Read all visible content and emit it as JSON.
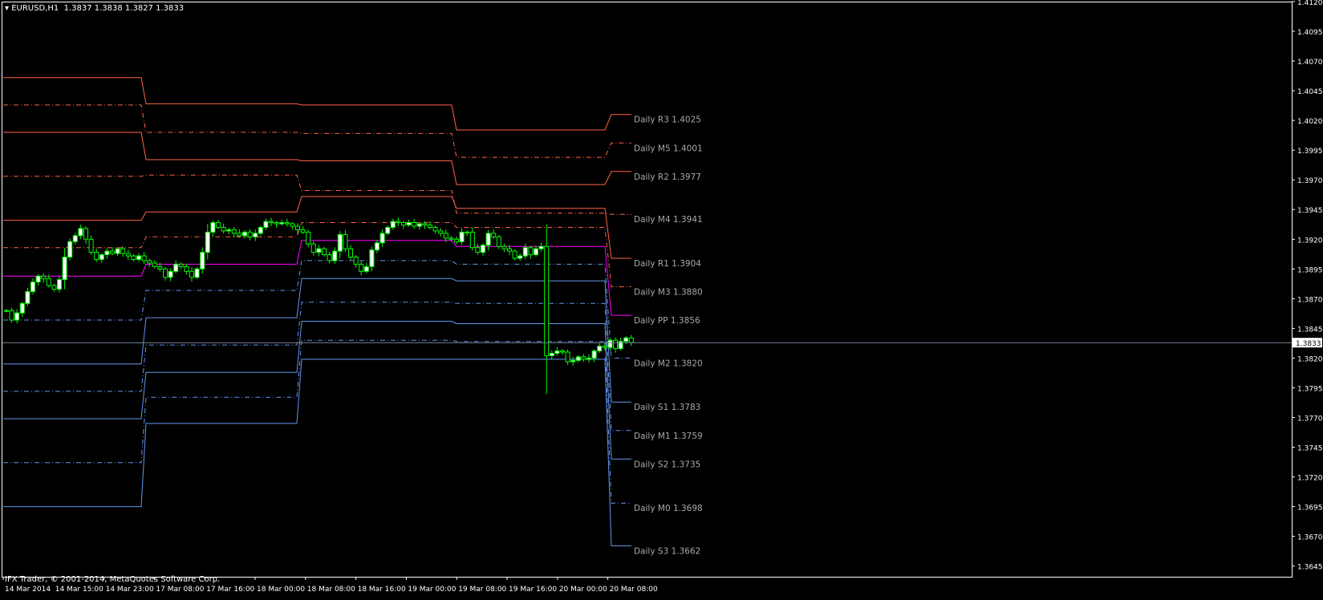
{
  "header": {
    "symbol": "EURUSD,H1",
    "ohlc": "1.3837 1.3838 1.3827 1.3833"
  },
  "footer": {
    "copyright": "IFX Trader, © 2001-2014, MetaQuotes Software Corp."
  },
  "current_price": "1.3833",
  "colors": {
    "background": "#000000",
    "frame": "#ffffff",
    "resistance": "#ff6347",
    "pivot": "#ff00ff",
    "support": "#6495ed",
    "label": "#a9a9a9",
    "bull_candle": "#ffffff",
    "wick": "#00ff00",
    "price_line": "#778899"
  },
  "chart_data": {
    "type": "candlestick",
    "ylim": [
      1.3636,
      1.412
    ],
    "y_ticks": [
      "1.4120",
      "1.4095",
      "1.4070",
      "1.4045",
      "1.4020",
      "1.3995",
      "1.3970",
      "1.3945",
      "1.3920",
      "1.3895",
      "1.3870",
      "1.3845",
      "1.3820",
      "1.3795",
      "1.3770",
      "1.3745",
      "1.3720",
      "1.3695",
      "1.3670",
      "1.3645"
    ],
    "x_ticks": [
      "14 Mar 2014",
      "14 Mar 15:00",
      "14 Mar 23:00",
      "17 Mar 08:00",
      "17 Mar 16:00",
      "18 Mar 00:00",
      "18 Mar 08:00",
      "18 Mar 16:00",
      "19 Mar 00:00",
      "19 Mar 08:00",
      "19 Mar 16:00",
      "20 Mar 00:00",
      "20 Mar 08:00"
    ],
    "pivot_levels": [
      {
        "name": "Daily R3",
        "label": "Daily R3 1.4025",
        "group": "resistance",
        "dash": "solid",
        "values": [
          1.4056,
          1.4034,
          1.4033,
          1.4012,
          1.4025
        ]
      },
      {
        "name": "Daily M5",
        "label": "Daily M5 1.4001",
        "group": "resistance",
        "dash": "dashdot",
        "values": [
          1.4033,
          1.401,
          1.4009,
          1.3989,
          1.4001
        ]
      },
      {
        "name": "Daily R2",
        "label": "Daily R2 1.3977",
        "group": "resistance",
        "dash": "solid",
        "values": [
          1.401,
          1.3987,
          1.3986,
          1.3966,
          1.3977
        ]
      },
      {
        "name": "Daily M4",
        "label": "Daily M4 1.3941",
        "group": "resistance",
        "dash": "dashdot",
        "values": [
          1.3973,
          1.3974,
          1.3961,
          1.3942,
          1.3941
        ]
      },
      {
        "name": "Daily R1",
        "label": "Daily R1 1.3904",
        "group": "resistance",
        "dash": "solid",
        "values": [
          1.3936,
          1.3943,
          1.3956,
          1.3946,
          1.3904
        ]
      },
      {
        "name": "Daily M3",
        "label": "Daily M3 1.3880",
        "group": "resistance",
        "dash": "dashdot",
        "values": [
          1.3913,
          1.3922,
          1.3934,
          1.393,
          1.388
        ]
      },
      {
        "name": "Daily PP",
        "label": "Daily PP 1.3856",
        "group": "pivot",
        "dash": "solid",
        "values": [
          1.3889,
          1.3899,
          1.3919,
          1.3914,
          1.3856
        ]
      },
      {
        "name": "Daily M2",
        "label": "Daily M2 1.3820",
        "group": "support",
        "dash": "dashdot",
        "values": [
          1.3852,
          1.3877,
          1.3902,
          1.3899,
          1.382
        ]
      },
      {
        "name": "Daily S1",
        "label": "Daily S1 1.3783",
        "group": "support",
        "dash": "solid",
        "values": [
          1.3815,
          1.3854,
          1.3887,
          1.3885,
          1.3783
        ]
      },
      {
        "name": "Daily M1",
        "label": "Daily M1 1.3759",
        "group": "support",
        "dash": "dashdot",
        "values": [
          1.3792,
          1.3831,
          1.3867,
          1.3866,
          1.3759
        ]
      },
      {
        "name": "Daily S2",
        "label": "Daily S2 1.3735",
        "group": "support",
        "dash": "solid",
        "values": [
          1.3769,
          1.3808,
          1.3851,
          1.3849,
          1.3735
        ]
      },
      {
        "name": "Daily M0",
        "label": "Daily M0 1.3698",
        "group": "support",
        "dash": "dashdot",
        "values": [
          1.3732,
          1.3787,
          1.3835,
          1.3834,
          1.3698
        ]
      },
      {
        "name": "Daily S3",
        "label": "Daily S3 1.3662",
        "group": "support",
        "dash": "solid",
        "values": [
          1.3695,
          1.3765,
          1.3819,
          1.3819,
          1.3662
        ]
      }
    ],
    "closes": [
      1.386,
      1.3852,
      1.3858,
      1.3866,
      1.3876,
      1.3884,
      1.3889,
      1.3887,
      1.3881,
      1.3878,
      1.3886,
      1.3905,
      1.3918,
      1.3923,
      1.3929,
      1.392,
      1.3909,
      1.3903,
      1.3907,
      1.391,
      1.3908,
      1.3912,
      1.3908,
      1.3906,
      1.3903,
      1.3906,
      1.3902,
      1.39,
      1.3897,
      1.3895,
      1.3888,
      1.3893,
      1.3899,
      1.3897,
      1.3893,
      1.3888,
      1.3895,
      1.3909,
      1.3926,
      1.3934,
      1.393,
      1.3927,
      1.3928,
      1.3925,
      1.3923,
      1.3926,
      1.3922,
      1.3925,
      1.393,
      1.3935,
      1.3934,
      1.3933,
      1.3934,
      1.3933,
      1.3931,
      1.3928,
      1.3926,
      1.3916,
      1.3909,
      1.3912,
      1.3907,
      1.3902,
      1.391,
      1.3924,
      1.3912,
      1.3905,
      1.3899,
      1.3893,
      1.3897,
      1.3911,
      1.3917,
      1.3925,
      1.393,
      1.3935,
      1.3934,
      1.3932,
      1.3934,
      1.3931,
      1.3933,
      1.3932,
      1.393,
      1.3927,
      1.3925,
      1.3921,
      1.392,
      1.3918,
      1.3926,
      1.3926,
      1.3913,
      1.3909,
      1.3915,
      1.3925,
      1.3922,
      1.3914,
      1.3912,
      1.391,
      1.3904,
      1.3906,
      1.3913,
      1.3907,
      1.3912,
      1.3914,
      1.3822,
      1.3824,
      1.3826,
      1.3825,
      1.3817,
      1.3818,
      1.3821,
      1.3819,
      1.382,
      1.3826,
      1.383,
      1.3829,
      1.3835,
      1.3828,
      1.3834,
      1.3837,
      1.3833
    ]
  }
}
